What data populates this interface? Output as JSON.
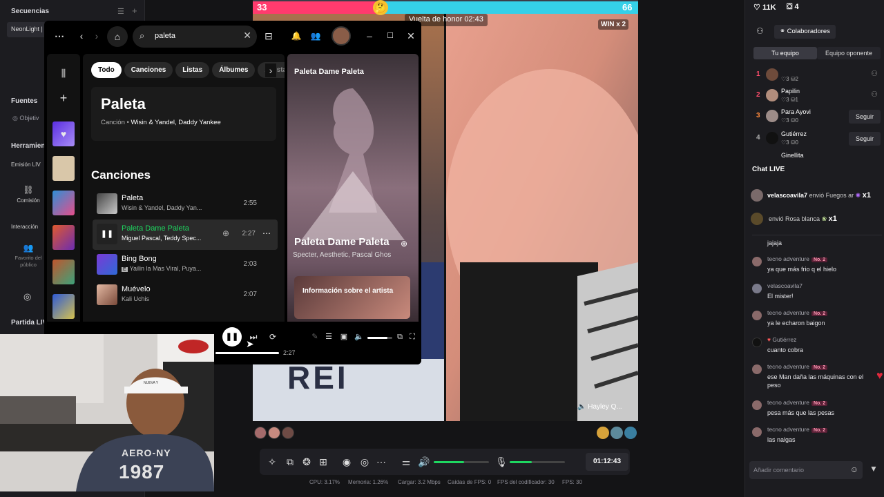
{
  "studio_left": {
    "sequences_label": "Secuencias",
    "scene_item": "NeonLight |",
    "fonts_label": "Fuentes",
    "objective_label": "Objetiv",
    "tools_label": "Herramien",
    "emission_label": "Emisión LIV",
    "commission_label": "Comisión",
    "interaction_label": "Interacción",
    "favorite_label": "Favorito del público",
    "match_label": "Partida LIV"
  },
  "spotify": {
    "search_value": "paleta",
    "filters": [
      "Todo",
      "Canciones",
      "Listas",
      "Álbumes",
      "Artistas"
    ],
    "top_result": {
      "title": "Paleta",
      "type": "Canción",
      "artists": "Wisin & Yandel, Daddy Yankee"
    },
    "songs_header": "Canciones",
    "tracks": [
      {
        "title": "Paleta",
        "artists": "Wisin & Yandel, Daddy Yan...",
        "duration": "2:55"
      },
      {
        "title": "Paleta Dame Paleta",
        "artists": "Miguel Pascal, Teddy Spec...",
        "duration": "2:27"
      },
      {
        "title": "Bing Bong",
        "artists": "Yailin la Mas Viral, Puya...",
        "duration": "2:03"
      },
      {
        "title": "Muévelo",
        "artists": "Kali Uchis",
        "duration": "2:07"
      }
    ],
    "explicit_mark": "E",
    "now_playing_panel": {
      "header": "Paleta Dame Paleta",
      "title": "Paleta Dame Paleta",
      "artists": "Specter, Aesthetic, Pascal Ghos",
      "artist_info": "Información sobre el artista"
    },
    "progress_time": "2:27",
    "volume_level": 0.8
  },
  "live": {
    "score_left": "33",
    "score_right": "66",
    "timer_label": "Vuelta de honor 02:43",
    "win_badge": "WIN x 2",
    "opponent_name": "Hayley Q...",
    "shirt_text": "REI"
  },
  "webcam": {
    "shirt_text": "AERO-NY",
    "shirt_number": "1987",
    "cap_text": "NUEVA Y"
  },
  "right_panel": {
    "likes": "11K",
    "gifts": "4",
    "collaborators_label": "Colaboradores",
    "tab_team": "Tu equipo",
    "tab_opponent": "Equipo oponente",
    "ranking": [
      {
        "rank": "1",
        "name": "",
        "stats": "♡3  ⛁2",
        "follow": ""
      },
      {
        "rank": "2",
        "name": "Papilin",
        "stats": "♡3  ⛁1",
        "follow": ""
      },
      {
        "rank": "3",
        "name": "Para Ayovi",
        "stats": "♡3  ⛁0",
        "follow": "Seguir"
      },
      {
        "rank": "4",
        "name": "Gutiérrez",
        "stats": "♡3  ⛁0",
        "follow": "Seguir"
      }
    ],
    "ranking_partial": "Ginellita",
    "chat_title": "Chat LIVE",
    "gift_events": [
      {
        "user": "velascoavila7",
        "text": "envió Fuegos ar",
        "count": "x1"
      },
      {
        "user": "",
        "text": "envió Rosa blanca",
        "count": "x1"
      }
    ],
    "chat": [
      {
        "user": "",
        "badge": "",
        "text": "jajaja"
      },
      {
        "user": "tecno adventure",
        "badge": "No. 2",
        "text": "ya que más frio q el hielo"
      },
      {
        "user": "velascoavila7",
        "badge": "",
        "text": "El mister!"
      },
      {
        "user": "tecno adventure",
        "badge": "No. 2",
        "text": "ya le echaron baigon"
      },
      {
        "user": "Gutiérrez",
        "badge": "",
        "text": "cuanto cobra"
      },
      {
        "user": "tecno adventure",
        "badge": "No. 2",
        "text": "ese Man daña las máquinas con el peso"
      },
      {
        "user": "tecno adventure",
        "badge": "No. 2",
        "text": "pesa más que las pesas"
      },
      {
        "user": "tecno adventure",
        "badge": "No. 2",
        "text": "las nalgas"
      }
    ],
    "comment_placeholder": "Añadir comentario"
  },
  "controls": {
    "timer": "01:12:43",
    "mic_level": 0.4,
    "speaker_level": 0.55
  },
  "status": {
    "cpu": "CPU: 3.17%",
    "memory": "Memoria: 1.26%",
    "upload": "Cargar: 3.2 Mbps",
    "fps_drops": "Caídas de FPS: 0",
    "encoder_fps": "FPS del codificador: 30",
    "fps": "FPS: 30"
  },
  "colors": {
    "spotify_green": "#1ed760",
    "tiktok_pink": "#ff3b6e",
    "tiktok_cyan": "#35d0e8"
  }
}
